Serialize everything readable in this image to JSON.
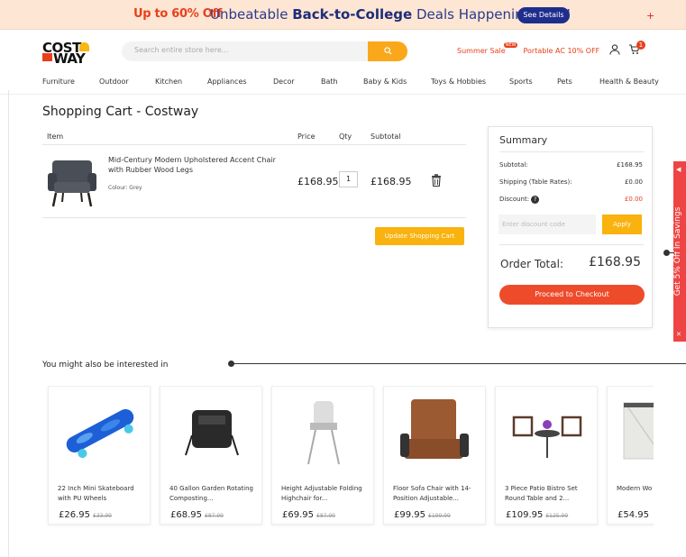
{
  "banner": {
    "promo": "Up to 60% Off",
    "msg_pre": "Unbeatable ",
    "msg_bold": "Back-to-College",
    "msg_post": " Deals Happening Now!",
    "details": "See Details",
    "flag": "+"
  },
  "brand": {
    "line1": "COST",
    "line2": "WAY"
  },
  "search": {
    "placeholder": "Search entire store here...",
    "icon": "search-icon"
  },
  "promos": {
    "sale": "Summer Sale",
    "new_badge": "NEW",
    "ac": "Portable AC 10% OFF"
  },
  "cart_count": "1",
  "nav": [
    "Furniture",
    "Outdoor",
    "Kitchen",
    "Appliances",
    "Decor",
    "Bath",
    "Baby & Kids",
    "Toys & Hobbies",
    "Sports",
    "Pets",
    "Health & Beauty"
  ],
  "page_title": "Shopping Cart - Costway",
  "table": {
    "headers": [
      "Item",
      "Price",
      "Qty",
      "Subtotal"
    ]
  },
  "item": {
    "name": "Mid-Century Modern Upholstered Accent Chair with Rubber Wood Legs",
    "colour": "Colour:  Grey",
    "price": "£168.95",
    "qty": "1",
    "subtotal": "£168.95"
  },
  "update_label": "Update Shopping Cart",
  "summary": {
    "title": "Summary",
    "subtotal_label": "Subtotal:",
    "subtotal": "£168.95",
    "shipping_label": "Shipping (Table Rates):",
    "shipping": "£0.00",
    "discount_label": "Discount:",
    "discount": "£0.00",
    "discount_placeholder": "Enter discount code",
    "apply": "Apply",
    "total_label": "Order Total:",
    "total": "£168.95",
    "checkout": "Proceed to Checkout"
  },
  "side_tab": {
    "text": "Get 5% Off In Savings",
    "arrow": "◀",
    "close": "✕"
  },
  "interested_title": "You might also be interested in",
  "products": [
    {
      "name": "22 Inch Mini Skateboard with PU Wheels",
      "price": "£26.95",
      "old": "£33.99"
    },
    {
      "name": "40 Gallon Garden Rotating Composting...",
      "price": "£68.95",
      "old": "£87.99"
    },
    {
      "name": "Height Adjustable Folding Highchair for...",
      "price": "£69.95",
      "old": "£87.99"
    },
    {
      "name": "Floor Sofa Chair with 14-Position Adjustable...",
      "price": "£99.95",
      "old": "£199.99"
    },
    {
      "name": "3 Piece Patio Bistro Set Round Table and 2...",
      "price": "£109.95",
      "old": "£125.99"
    },
    {
      "name": "Modern Wo Cabinet wi",
      "price": "£54.95",
      "old": ""
    }
  ]
}
